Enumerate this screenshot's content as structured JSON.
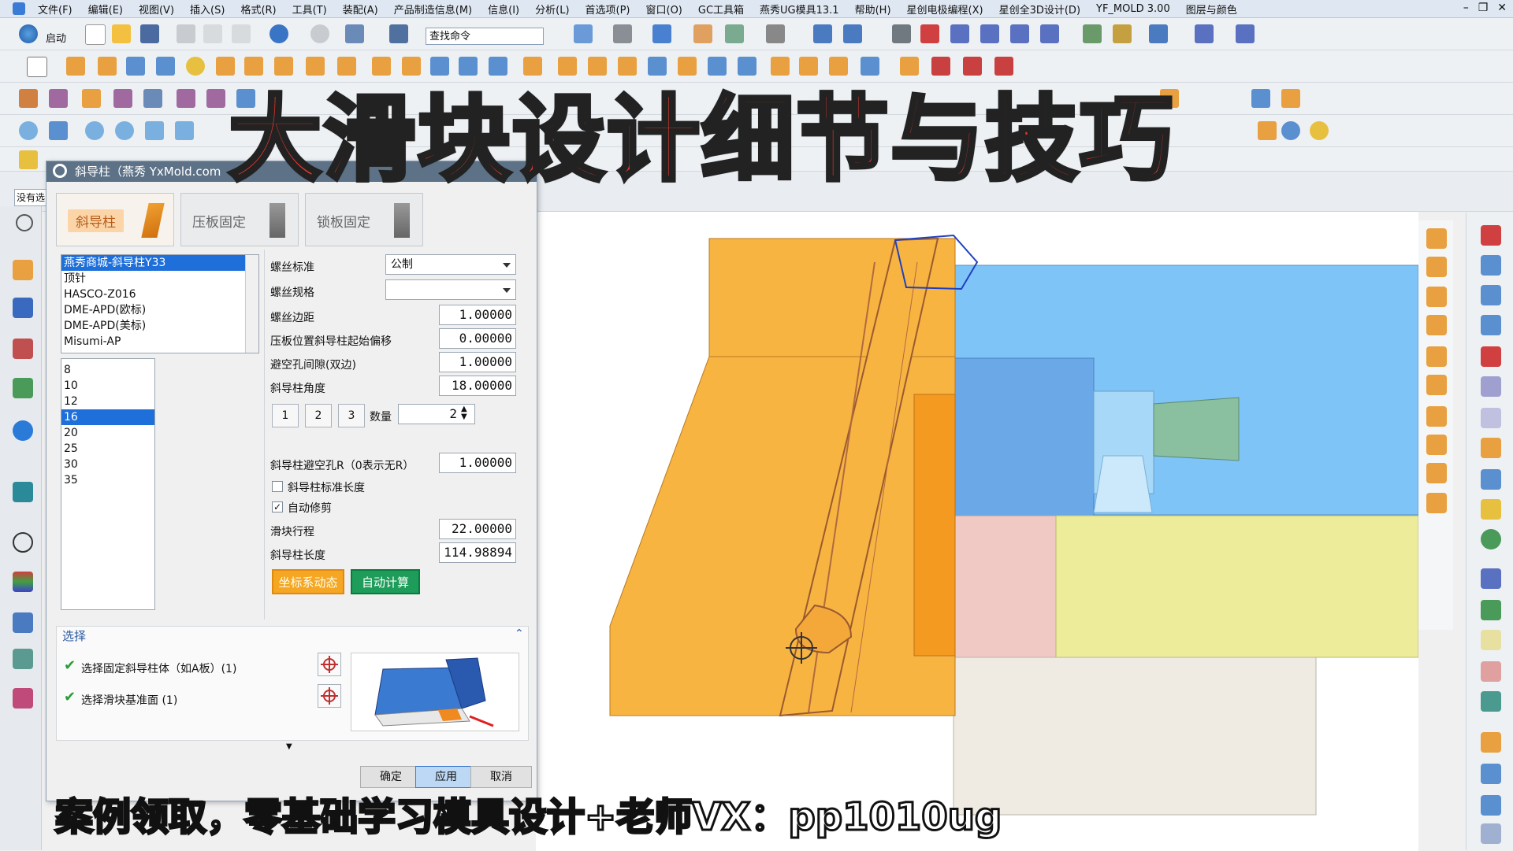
{
  "menu": {
    "items": [
      "文件(F)",
      "编辑(E)",
      "视图(V)",
      "插入(S)",
      "格式(R)",
      "工具(T)",
      "装配(A)",
      "产品制造信息(M)",
      "信息(I)",
      "分析(L)",
      "首选项(P)",
      "窗口(O)",
      "GC工具箱",
      "燕秀UG模具13.1",
      "帮助(H)",
      "星创电极编程(X)",
      "星创全3D设计(D)",
      "YF_MOLD  3.00",
      "图层与颜色"
    ]
  },
  "toolbar": {
    "start_label": "启动",
    "search_placeholder": "查找命令"
  },
  "leftbar": {
    "selection_filter": "没有选"
  },
  "dialog": {
    "title": "斜导柱（燕秀 YxMold.com",
    "tabs": [
      {
        "label": "斜导柱"
      },
      {
        "label": "压板固定"
      },
      {
        "label": "锁板固定"
      }
    ],
    "standards": [
      "燕秀商城-斜导柱Y33",
      "顶针",
      "HASCO-Z016",
      "DME-APD(欧标)",
      "DME-APD(美标)",
      "Misumi-AP"
    ],
    "standards_selected": "燕秀商城-斜导柱Y33",
    "diameters": [
      "8",
      "10",
      "12",
      "16",
      "20",
      "25",
      "30",
      "35"
    ],
    "diameter_selected": "16",
    "params": {
      "screw_standard_label": "螺丝标准",
      "screw_standard_value": "公制",
      "screw_spec_label": "螺丝规格",
      "screw_spec_value": "",
      "screw_edge_label": "螺丝边距",
      "screw_edge_value": "1.00000",
      "plate_offset_label": "压板位置斜导柱起始偏移",
      "plate_offset_value": "0.00000",
      "clearance_label": "避空孔间隙(双边)",
      "clearance_value": "1.00000",
      "angle_label": "斜导柱角度",
      "angle_value": "18.00000",
      "btn1": "1",
      "btn2": "2",
      "btn3": "3",
      "qty_label": "数量",
      "qty_value": "2",
      "radius_label": "斜导柱避空孔R（0表示无R）",
      "radius_value": "1.00000",
      "std_len_label": "斜导柱标准长度",
      "std_len_checked": false,
      "auto_trim_label": "自动修剪",
      "auto_trim_checked": true,
      "stroke_label": "滑块行程",
      "stroke_value": "22.00000",
      "length_label": "斜导柱长度",
      "length_value": "114.98894",
      "coord_btn": "坐标系动态",
      "auto_calc_btn": "自动计算"
    },
    "selection": {
      "header": "选择",
      "item1": "选择固定斜导柱体（如A板）(1)",
      "item2": "选择滑块基准面 (1)"
    },
    "footer": {
      "ok": "确定",
      "apply": "应用",
      "cancel": "取消"
    }
  },
  "overlay": {
    "title": "大滑块设计细节与技巧",
    "caption": "案例领取，零基础学习模具设计+老师VX：pp1010ug"
  },
  "colors": {
    "accent_orange": "#f5a623",
    "title_red": "#e8392b",
    "cavity_blue": "#7ec4f7",
    "plate_yellow": "#ecec9a"
  }
}
